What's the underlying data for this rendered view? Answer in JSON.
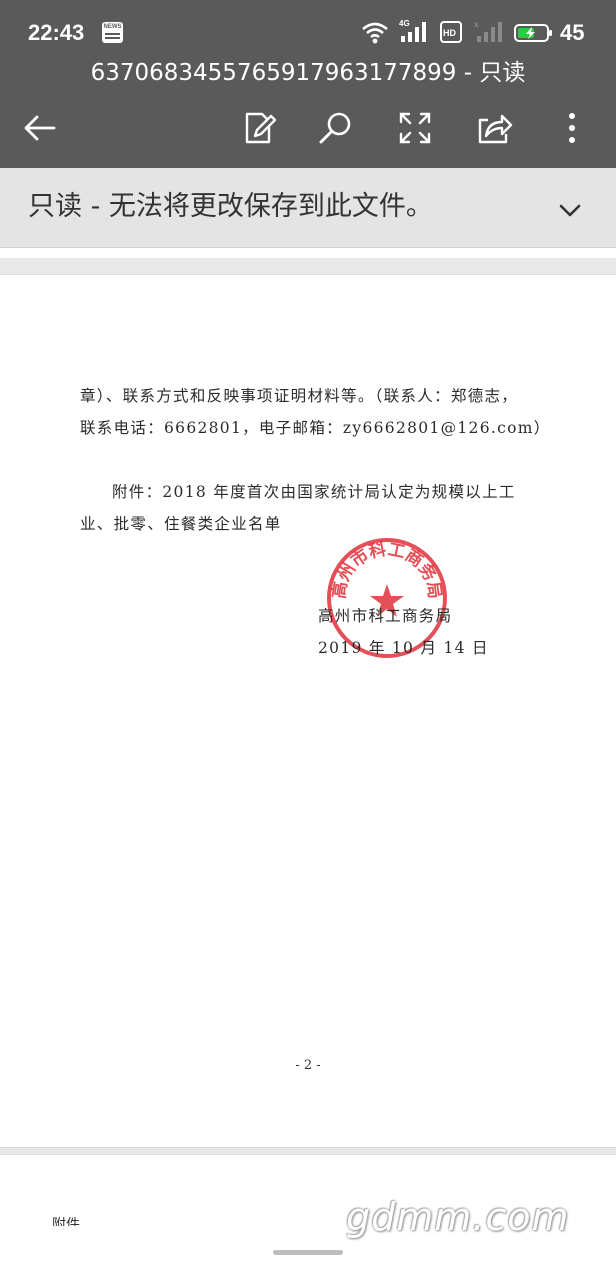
{
  "status_bar": {
    "time": "22:43",
    "news_label": "NEWS",
    "network_label": "4G",
    "hd_label": "HD",
    "battery_level": "45",
    "icons": [
      "news-icon",
      "wifi-icon",
      "signal-4g-icon",
      "hd-icon",
      "signal-empty-icon",
      "battery-charging-icon"
    ]
  },
  "app_bar": {
    "title": "637068345576591796317789​9 - 只读",
    "tools": [
      "back-arrow-icon",
      "edit-icon",
      "search-icon",
      "fullscreen-icon",
      "share-icon",
      "more-vert-icon"
    ]
  },
  "banner": {
    "text": "只读 - 无法将更改保存到此文件。",
    "icon": "chevron-down-icon"
  },
  "document": {
    "lines": [
      "章）、联系方式和反映事项证明材料等。（联系人：郑德志，",
      "联系电话：6662801，电子邮箱：zy6662801@126.com）",
      "附件：2018 年度首次由国家统计局认定为规模以上工",
      "业、批零、住餐类企业名单",
      "高州市科工商务局",
      "2019 年 10 月 14 日"
    ],
    "seal_text": "高州市科工商务局",
    "page_number": "- 2 -",
    "next_page_text": "附件"
  },
  "watermark": "gdmm.com",
  "colors": {
    "app_bar": "#5a5a5a",
    "banner": "#e4e4e4",
    "seal": "#e0303a"
  }
}
